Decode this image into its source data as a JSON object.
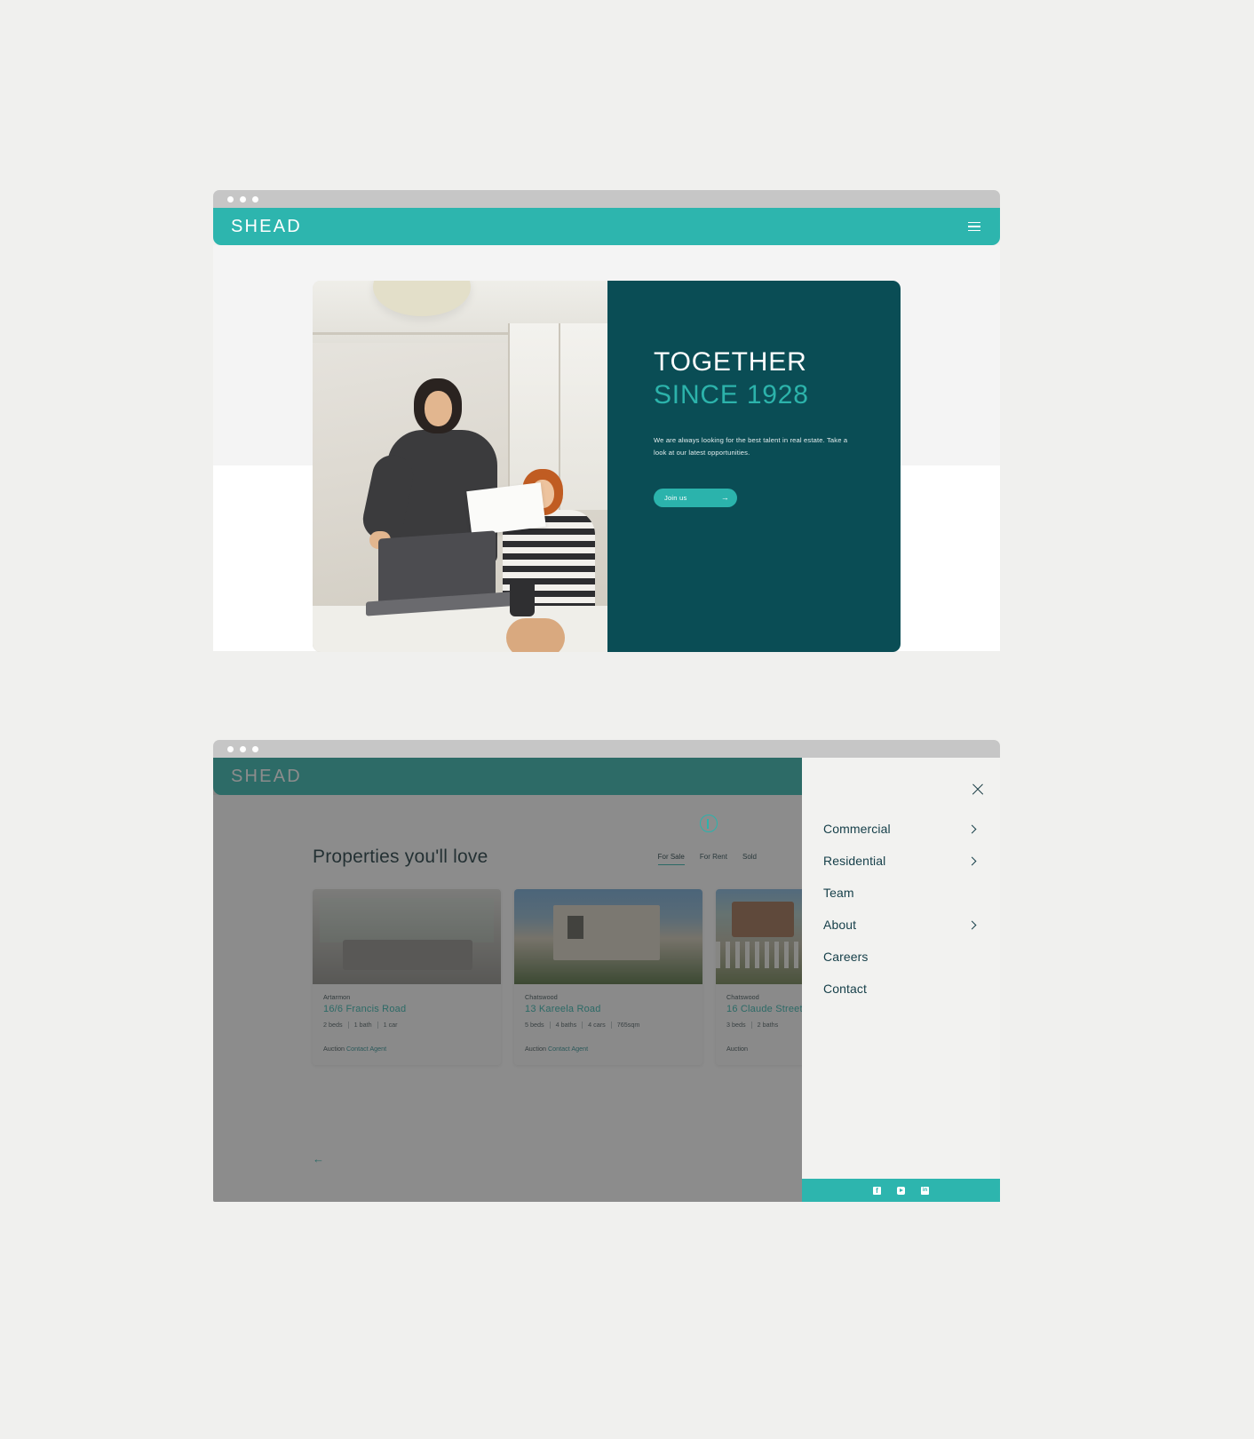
{
  "theme": {
    "teal": "#2db5ae",
    "dark_teal": "#0a4d55",
    "page_bg": "#f0f0ee",
    "heading_color": "#17404a"
  },
  "window_one": {
    "brand": "SHEAD",
    "menu_icon": "hamburger-icon",
    "hero": {
      "headline_line1": "TOGETHER",
      "headline_line2": "SINCE 1928",
      "paragraph": "We are always looking for the best talent in real estate. Take a look at our latest opportunities.",
      "cta_label": "Join us",
      "cta_arrow": "→",
      "photo_alt": "office-team-photo"
    }
  },
  "window_two": {
    "brand": "SHEAD",
    "section_title": "Properties you'll love",
    "tabs": [
      {
        "label": "For Sale",
        "active": true
      },
      {
        "label": "For Rent",
        "active": false
      },
      {
        "label": "Sold",
        "active": false
      }
    ],
    "back_arrow": "←",
    "cards": [
      {
        "suburb": "Artarmon",
        "address": "16/6 Francis Road",
        "specs": [
          "2 beds",
          "1 bath",
          "1 car"
        ],
        "status": "Auction",
        "link": "Contact Agent",
        "image": "interior-living-room"
      },
      {
        "suburb": "Chatswood",
        "address": "13 Kareela Road",
        "specs": [
          "5 beds",
          "4 baths",
          "4 cars",
          "765sqm"
        ],
        "status": "Auction",
        "link": "Contact Agent",
        "image": "house-exterior-garage"
      },
      {
        "suburb": "Chatswood",
        "address": "16 Claude Street",
        "specs": [
          "3 beds",
          "2 baths"
        ],
        "status": "Auction",
        "link": "",
        "image": "cottage-white-fence"
      }
    ],
    "menu_panel": {
      "close_icon": "close-icon",
      "items": [
        {
          "label": "Commercial",
          "has_submenu": true
        },
        {
          "label": "Residential",
          "has_submenu": true
        },
        {
          "label": "Team",
          "has_submenu": false
        },
        {
          "label": "About",
          "has_submenu": true
        },
        {
          "label": "Careers",
          "has_submenu": false
        },
        {
          "label": "Contact",
          "has_submenu": false
        }
      ],
      "social": [
        {
          "name": "facebook-icon"
        },
        {
          "name": "youtube-icon"
        },
        {
          "name": "linkedin-icon"
        }
      ]
    }
  }
}
